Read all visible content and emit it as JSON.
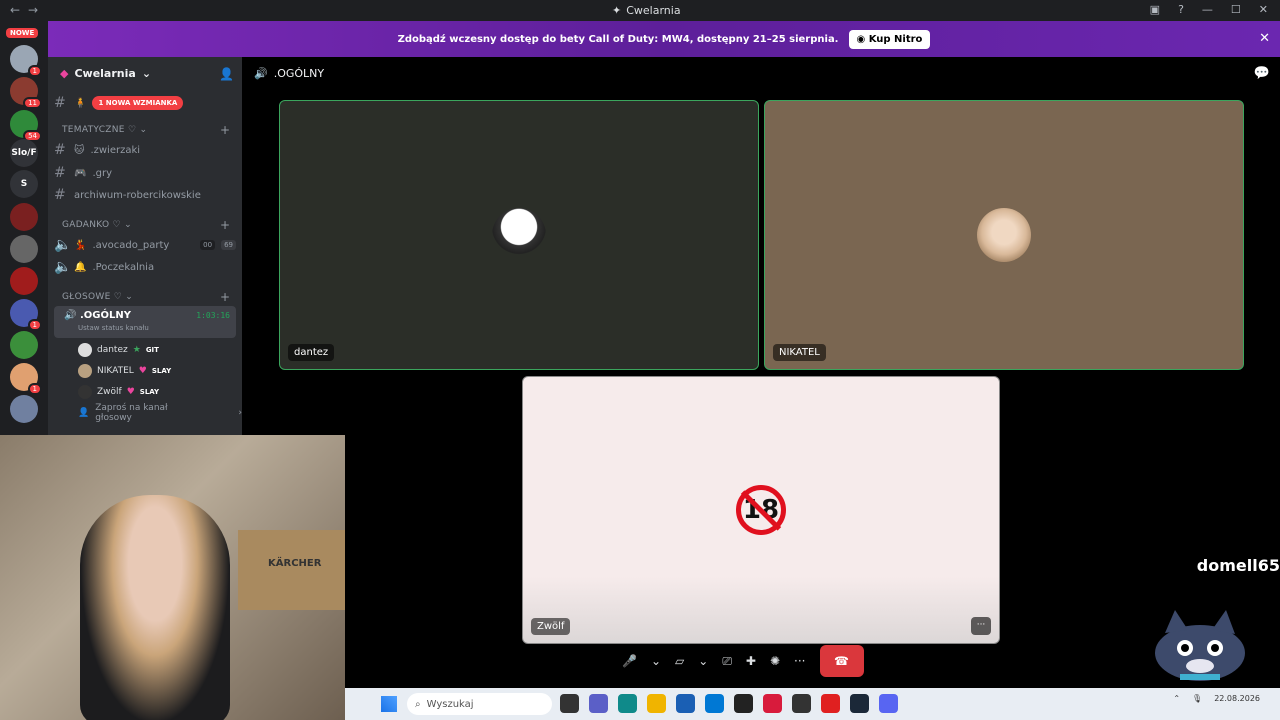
{
  "window": {
    "title": "Cwelarnia"
  },
  "banner": {
    "text": "Zdobądź wczesny dostęp do bety Call of Duty: MW4, dostępny 21–25 sierpnia.",
    "button": "Kup Nitro"
  },
  "guilds": {
    "nowe": "NOWE",
    "badges": [
      "1",
      "11",
      "54",
      "1",
      "1"
    ],
    "text_items": [
      "Slo/F",
      "S"
    ]
  },
  "server": {
    "name": "Cwelarnia"
  },
  "channels": {
    "mention_badge": "1 NOWA WZMIANKA",
    "cat1": "TEMATYCZNE",
    "zwierzaki": ".zwierzaki",
    "gry": ".gry",
    "archiwum": "archiwum-robercikowskie",
    "cat2": "GADANKO",
    "avocado": ".avocado_party",
    "avocado_counts": [
      "00",
      "69"
    ],
    "poczekalnia": ".Poczekalnia",
    "cat3": "GŁOSOWE",
    "active": ".OGÓLNY",
    "timer": "1:03:16",
    "status": "Ustaw status kanału",
    "users": [
      {
        "name": "dantez",
        "tag": "GIT"
      },
      {
        "name": "NIKATEL",
        "tag": "SLAY"
      },
      {
        "name": "Zwölf",
        "tag": "SLAY"
      }
    ],
    "invite": "Zaproś na kanał głosowy"
  },
  "main": {
    "channel": ".OGÓLNY"
  },
  "tiles": {
    "t1": "dantez",
    "t2": "NIKATEL",
    "t3": "Zwölf",
    "sign": "18"
  },
  "stream": {
    "username": "domell65",
    "box_text": "KÄRCHER"
  },
  "taskbar": {
    "search_placeholder": "Wyszukaj",
    "date": "22.08.2026"
  },
  "icons": {
    "mic": "microphone-icon",
    "camera": "camera-off-icon",
    "screen": "screen-share-icon",
    "activity": "activity-icon",
    "soundboard": "soundboard-icon",
    "more": "more-icon",
    "hangup": "hangup-icon"
  }
}
